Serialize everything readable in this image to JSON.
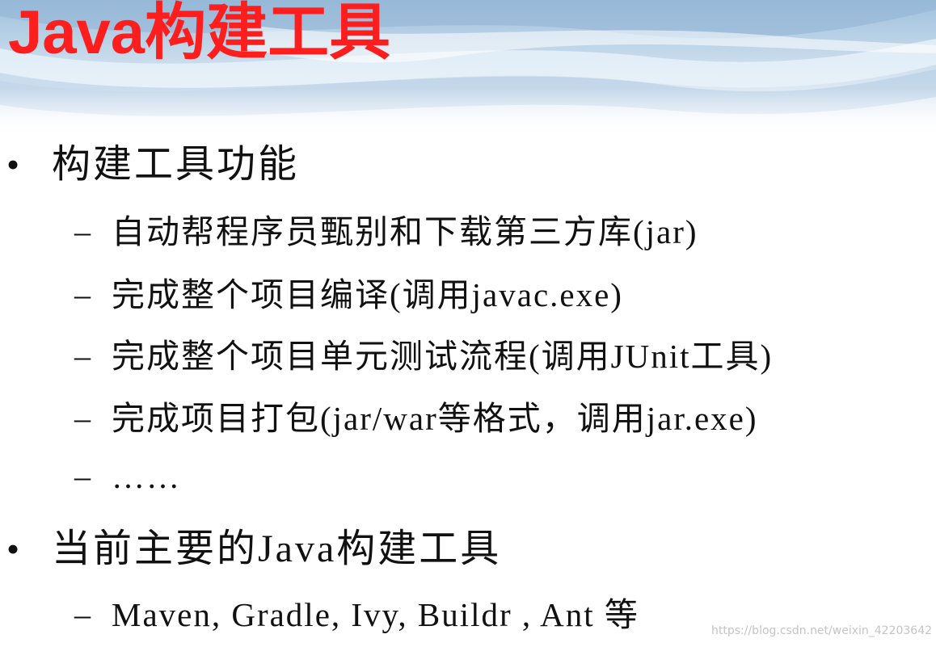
{
  "slide": {
    "title": "Java构建工具",
    "bullets": [
      {
        "text": "构建工具功能",
        "sub": [
          "自动帮程序员甄别和下载第三方库(jar)",
          "完成整个项目编译(调用javac.exe)",
          "完成整个项目单元测试流程(调用JUnit工具)",
          "完成项目打包(jar/war等格式，调用jar.exe)",
          "……"
        ]
      },
      {
        "text": "当前主要的Java构建工具",
        "sub": [
          "Maven, Gradle, Ivy, Buildr , Ant 等"
        ]
      }
    ],
    "bullet_symbol": "•",
    "dash_symbol": "–"
  },
  "watermark": "https://blog.csdn.net/weixin_42203642",
  "colors": {
    "title": "#ff1e1e",
    "body_text": "#111111",
    "header_sky": "#bcd3e8",
    "watermark": "#c4c4c4"
  }
}
